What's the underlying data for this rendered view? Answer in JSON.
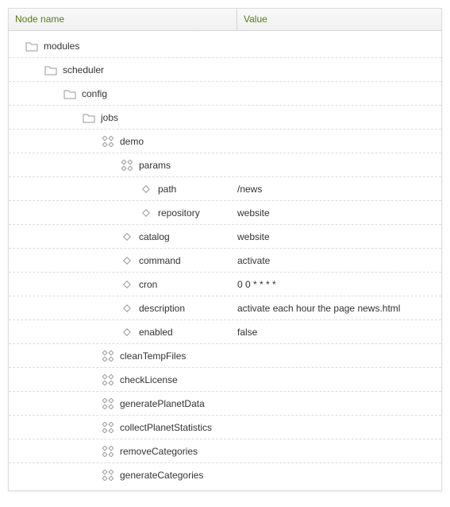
{
  "headers": {
    "name": "Node name",
    "value": "Value"
  },
  "rows": [
    {
      "indent": 0,
      "icon": "folder",
      "label": "modules",
      "value": ""
    },
    {
      "indent": 1,
      "icon": "folder",
      "label": "scheduler",
      "value": ""
    },
    {
      "indent": 2,
      "icon": "folder",
      "label": "config",
      "value": ""
    },
    {
      "indent": 3,
      "icon": "folder",
      "label": "jobs",
      "value": ""
    },
    {
      "indent": 4,
      "icon": "quad",
      "label": "demo",
      "value": ""
    },
    {
      "indent": 5,
      "icon": "quad",
      "label": "params",
      "value": ""
    },
    {
      "indent": 6,
      "icon": "diamond",
      "label": "path",
      "value": "/news"
    },
    {
      "indent": 6,
      "icon": "diamond",
      "label": "repository",
      "value": "website"
    },
    {
      "indent": 5,
      "icon": "diamond",
      "label": "catalog",
      "value": "website"
    },
    {
      "indent": 5,
      "icon": "diamond",
      "label": "command",
      "value": "activate"
    },
    {
      "indent": 5,
      "icon": "diamond",
      "label": "cron",
      "value": "0 0 * * * *"
    },
    {
      "indent": 5,
      "icon": "diamond",
      "label": "description",
      "value": "activate each hour the page news.html"
    },
    {
      "indent": 5,
      "icon": "diamond",
      "label": "enabled",
      "value": "false"
    },
    {
      "indent": 4,
      "icon": "quad",
      "label": "cleanTempFiles",
      "value": ""
    },
    {
      "indent": 4,
      "icon": "quad",
      "label": "checkLicense",
      "value": ""
    },
    {
      "indent": 4,
      "icon": "quad",
      "label": "generatePlanetData",
      "value": ""
    },
    {
      "indent": 4,
      "icon": "quad",
      "label": "collectPlanetStatistics",
      "value": ""
    },
    {
      "indent": 4,
      "icon": "quad",
      "label": "removeCategories",
      "value": ""
    },
    {
      "indent": 4,
      "icon": "quad",
      "label": "generateCategories",
      "value": ""
    }
  ],
  "indentBase": 20,
  "indentStep": 24
}
